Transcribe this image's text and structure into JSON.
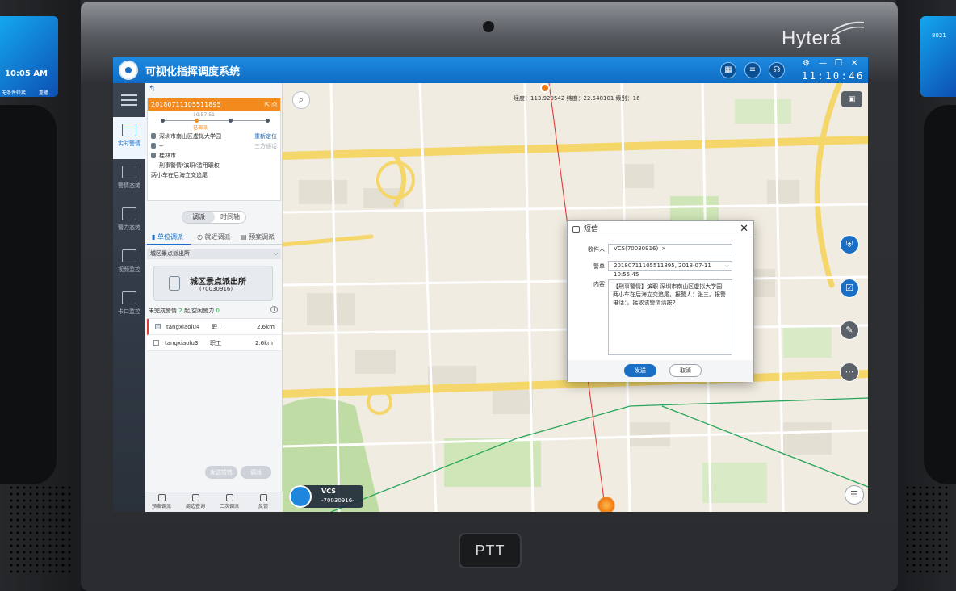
{
  "device": {
    "brand": "Hytera",
    "ptt_label": "PTT",
    "left_mini": {
      "time": "10:05 AM",
      "label1": "无条件转接",
      "label2": "重播"
    },
    "right_mini": {
      "num": "8021"
    }
  },
  "app": {
    "title": "可视化指挥调度系统",
    "clock": "11:10:46"
  },
  "nav": {
    "items": [
      {
        "label": "实时警情",
        "active": true
      },
      {
        "label": "警情态势"
      },
      {
        "label": "警力态势"
      },
      {
        "label": "视频监控"
      },
      {
        "label": "卡口监控"
      }
    ]
  },
  "incident": {
    "id": "20180711105511895",
    "time": "10:57:51",
    "status": "已调派",
    "address": "深圳市南山区虚拟大学园",
    "relocate": "重新定位",
    "caller": "--",
    "third_party": "三方通话",
    "city": "桂林市",
    "category": "刑事警情/滨职/滥用职权",
    "desc": "两小车在后海立交追尾"
  },
  "toggle": {
    "on": "调派",
    "off": "时间轴"
  },
  "tabs": [
    "单位调派",
    "就近调派",
    "预案调派"
  ],
  "unit": {
    "group": "城区景点派出所",
    "name": "城区景点派出所",
    "code": "(70030916)",
    "stat_prefix": "未完成警情",
    "unfinished": "2",
    "stat_mid": "起,空闲警力",
    "idle": "0"
  },
  "officers": [
    {
      "name": "tangxiaolu4",
      "role": "职工",
      "dist": "2.6km",
      "checked": true
    },
    {
      "name": "tangxiaolu3",
      "role": "职工",
      "dist": "2.6km",
      "checked": false
    }
  ],
  "panel_buttons": {
    "sms": "发送短信",
    "dispatch": "调派"
  },
  "bottom_tools": [
    "预案调派",
    "周边查询",
    "二次调派",
    "反馈"
  ],
  "map": {
    "info": "经度：113.929542    纬度：22.548101    级别：16",
    "vcs_name": "VCS",
    "vcs_code": "-70030916-"
  },
  "dialog": {
    "title": "短信",
    "recipient_label": "收件人",
    "recipient": "VCS(70030916)",
    "case_label": "警单",
    "case": "20180711105511895, 2018-07-11 10:55:45",
    "content_label": "内容",
    "content": "【刑事警情】滨职 深圳市南山区虚拟大学园 两小车在后海立交追尾。报警人：张三。报警电话：。接收该警情请按2",
    "send": "发送",
    "cancel": "取消"
  }
}
